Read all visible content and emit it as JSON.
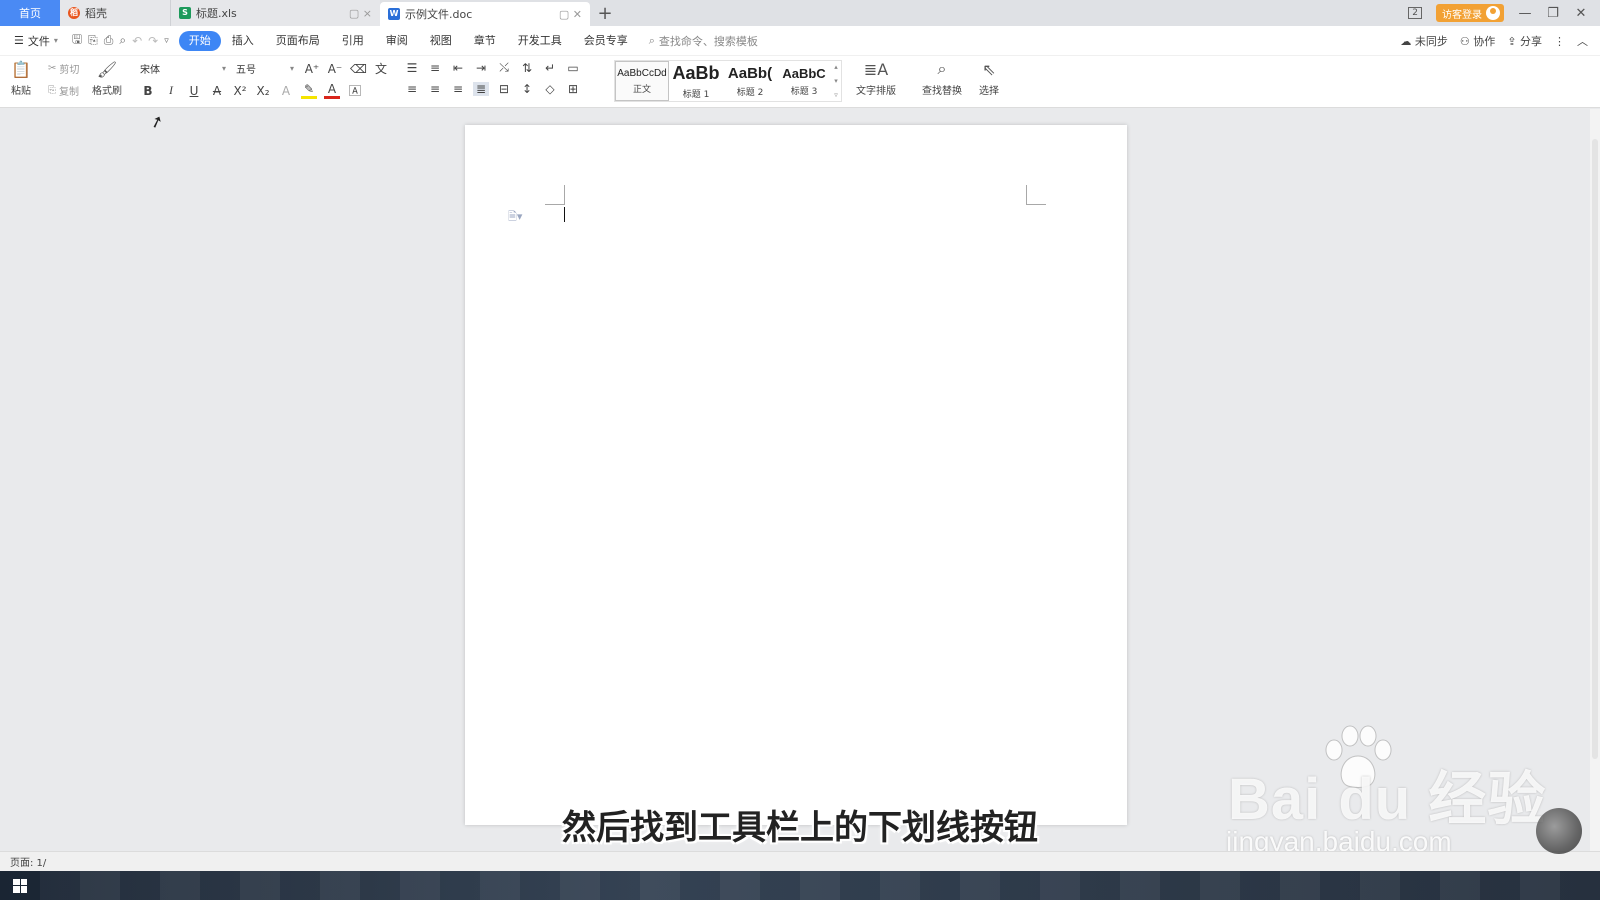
{
  "tabs": [
    {
      "label": "首页",
      "icon": "home"
    },
    {
      "label": "稻壳",
      "icon": "docer-icon"
    },
    {
      "label": "标题.xls",
      "icon": "spreadsheet-icon"
    },
    {
      "label": "示例文件.doc",
      "icon": "word-doc-icon"
    }
  ],
  "titlebar": {
    "page_count": "2",
    "login_label": "访客登录"
  },
  "menu": {
    "file_label": "文件",
    "items": [
      "开始",
      "插入",
      "页面布局",
      "引用",
      "审阅",
      "视图",
      "章节",
      "开发工具",
      "会员专享"
    ],
    "active": "开始",
    "search_placeholder": "查找命令、搜索模板",
    "sync_label": "未同步",
    "collab_label": "协作",
    "share_label": "分享"
  },
  "ribbon": {
    "paste_label": "粘贴",
    "cut_label": "剪切",
    "copy_label": "复制",
    "format_painter_label": "格式刷",
    "font_name": "宋体",
    "font_size": "五号",
    "styles": [
      {
        "preview": "AaBbCcDd",
        "caption": "正文"
      },
      {
        "preview": "AaBb",
        "caption": "标题 1"
      },
      {
        "preview": "AaBb(",
        "caption": "标题 2"
      },
      {
        "preview": "AaBbC",
        "caption": "标题 3"
      }
    ],
    "text_layout_label": "文字排版",
    "find_replace_label": "查找替换",
    "select_label": "选择"
  },
  "status": {
    "page_label": "页面: 1/"
  },
  "overlay": {
    "subtitle": "然后找到工具栏上的下划线按钮",
    "watermark_brand": "Bai  du 经验",
    "watermark_url": "jingyan.baidu.com"
  },
  "colors": {
    "accent": "#3d86f5",
    "home_tab": "#4a8af4",
    "login": "#f2a134",
    "docer": "#e8561f",
    "xls": "#1d9a5b",
    "doc": "#2b6fd8"
  }
}
